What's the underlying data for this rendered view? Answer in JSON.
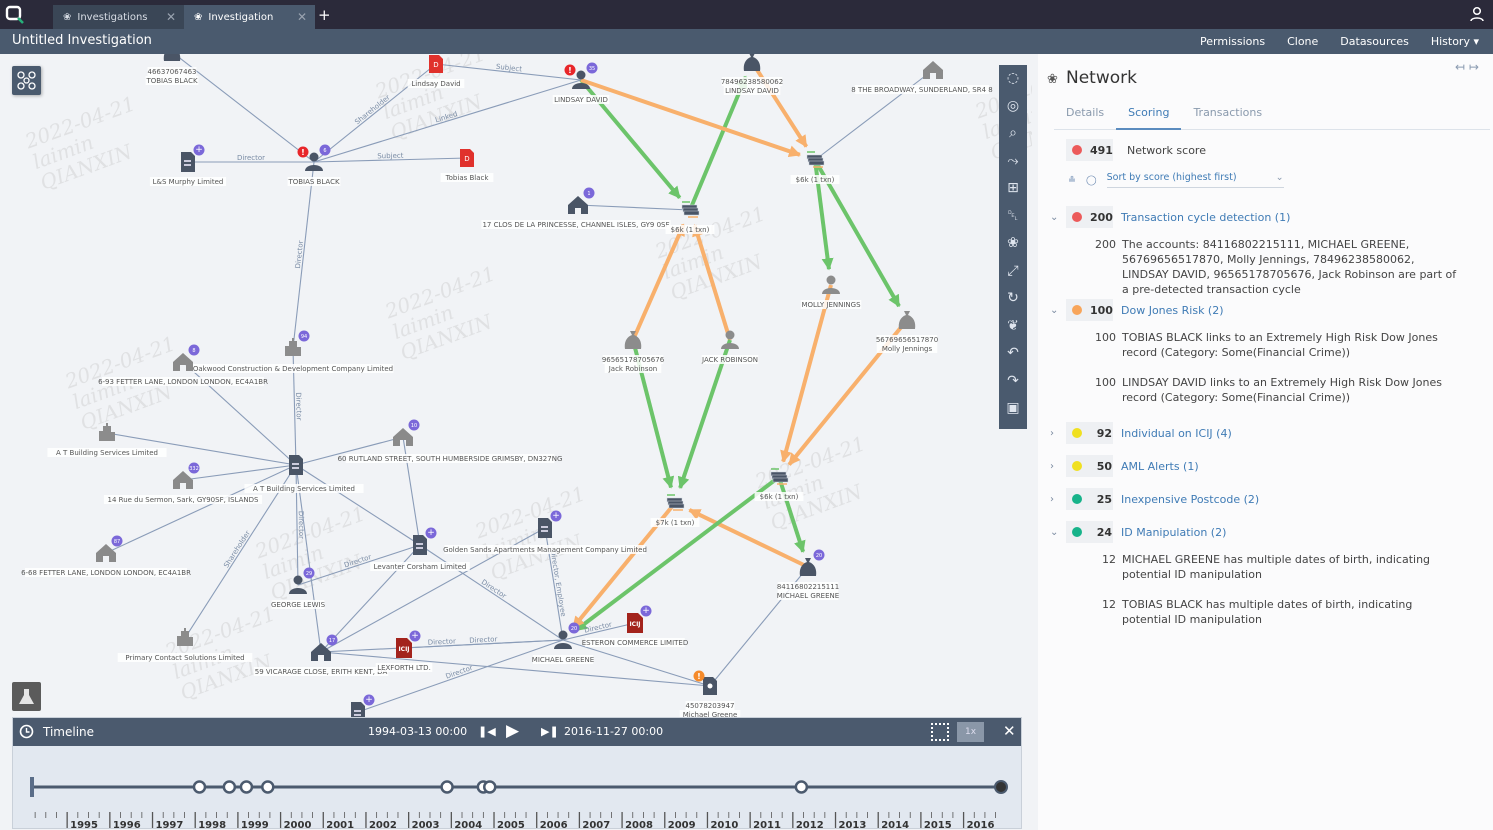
{
  "app": {
    "tabs": [
      {
        "label": "Investigations",
        "icon": "network-icon",
        "active": false
      },
      {
        "label": "Investigation",
        "icon": "network-icon",
        "active": true
      }
    ],
    "title": "Untitled Investigation",
    "menu": [
      "Permissions",
      "Clone",
      "Datasources",
      "History"
    ]
  },
  "watermark": "2022-04-21\nlaimin\nQIANXIN",
  "colors": {
    "green": "#6cc46a",
    "orange": "#f8b06c",
    "link": "#8a9cb8",
    "badge": "#7b68d9",
    "alert_red": "#e8262a",
    "alert_orange": "#f58a2a",
    "icij_red": "#a3231c",
    "doc_red": "#e0312c"
  },
  "graph": {
    "nodes": [
      {
        "id": "acct_tobias",
        "type": "moneybag",
        "label": [
          "46637067463",
          "TOBIAS BLACK"
        ]
      },
      {
        "id": "doc_lindsay",
        "type": "doc-red",
        "label": [
          "Lindsay David"
        ]
      },
      {
        "id": "tobias",
        "type": "person",
        "label": [
          "TOBIAS BLACK"
        ],
        "alert": "red",
        "badge": "6"
      },
      {
        "id": "lsmurphy",
        "type": "company",
        "label": [
          "L&S Murphy Limited"
        ],
        "badge": "+"
      },
      {
        "id": "doc_tobias",
        "type": "doc-red",
        "label": [
          "Tobias Black"
        ]
      },
      {
        "id": "lindsay",
        "type": "person",
        "label": [
          "LINDSAY DAVID"
        ],
        "alert": "red",
        "badge": "35"
      },
      {
        "id": "acct_lindsay",
        "type": "moneybag",
        "label": [
          "78496238580062",
          "LINDSAY DAVID"
        ]
      },
      {
        "id": "broadway",
        "type": "house-gray",
        "label": [
          "8 THE BROADWAY, SUNDERLAND, SR4 8"
        ]
      },
      {
        "id": "clos",
        "type": "house",
        "label": [
          "17 CLOS DE LA PRINCESSE, CHANNEL ISLES, GY9 0SF"
        ],
        "badge": "1"
      },
      {
        "id": "txn1",
        "type": "txn",
        "label": [
          "$6k (1 txn)"
        ]
      },
      {
        "id": "txn2",
        "type": "txn",
        "label": [
          "$6k (1 txn)"
        ]
      },
      {
        "id": "acct_jack",
        "type": "moneybag-gray",
        "label": [
          "96565178705676",
          "Jack Robinson"
        ]
      },
      {
        "id": "jack",
        "type": "person-gray",
        "label": [
          "JACK ROBINSON"
        ]
      },
      {
        "id": "molly",
        "type": "person-gray",
        "label": [
          "MOLLY JENNINGS"
        ]
      },
      {
        "id": "acct_molly",
        "type": "moneybag-gray",
        "label": [
          "56769656517870",
          "Molly Jennings"
        ]
      },
      {
        "id": "oakwood",
        "type": "building",
        "label": [
          "Oakwood Construction & Development Company Limited"
        ],
        "badge": "94"
      },
      {
        "id": "fetter93",
        "type": "house-gray",
        "label": [
          "6-93 FETTER LANE, LONDON LONDON, EC4A1BR"
        ],
        "badge": "8"
      },
      {
        "id": "atbs_bldg",
        "type": "building",
        "label": [
          "A T Building Services Limited"
        ]
      },
      {
        "id": "atbs",
        "type": "company",
        "label": [
          "A T Building Services Limited"
        ]
      },
      {
        "id": "rutland",
        "type": "none",
        "label": [
          "60 RUTLAND STREET, SOUTH HUMBERSIDE GRIMSBY, DN327NG"
        ]
      },
      {
        "id": "house10",
        "type": "house-gray",
        "label": [],
        "badge": "10"
      },
      {
        "id": "rue",
        "type": "house-gray",
        "label": [
          "14 Rue du Sermon, Sark, GY90SF, ISLANDS"
        ],
        "badge": "332"
      },
      {
        "id": "fetter68",
        "type": "house-gray",
        "label": [
          "6-68 FETTER LANE, LONDON LONDON, EC4A1BR"
        ],
        "badge": "87"
      },
      {
        "id": "george",
        "type": "person",
        "label": [
          "GEORGE LEWIS"
        ],
        "badge": "29"
      },
      {
        "id": "levanter",
        "type": "company",
        "label": [
          "Levanter Corsham Limited"
        ],
        "badge": "+"
      },
      {
        "id": "golden",
        "type": "company",
        "label": [
          "Golden Sands Apartments Management Company Limited"
        ],
        "badge": "+"
      },
      {
        "id": "txn3",
        "type": "txn",
        "label": [
          "$7k (1 txn)"
        ]
      },
      {
        "id": "txn4",
        "type": "txn",
        "label": [
          "$6k (1 txn)"
        ]
      },
      {
        "id": "acct_michael",
        "type": "moneybag",
        "label": [
          "84116802215111",
          "MICHAEL GREENE"
        ],
        "badge": "20"
      },
      {
        "id": "primary",
        "type": "building",
        "label": [
          "Primary Contact Solutions Limited"
        ]
      },
      {
        "id": "vicarage",
        "type": "house",
        "label": [
          "59 VICARAGE CLOSE, ERITH KENT, DA"
        ],
        "badge": "17"
      },
      {
        "id": "lexforth",
        "type": "icij",
        "label": [
          "LEXFORTH LTD."
        ],
        "badge": "+"
      },
      {
        "id": "michael",
        "type": "person",
        "label": [
          "MICHAEL GREENE"
        ],
        "badge": "20"
      },
      {
        "id": "esteron",
        "type": "icij",
        "label": [
          "ESTERON COMMERCE LIMITED"
        ],
        "badge": "+"
      },
      {
        "id": "id_michael",
        "type": "id-doc",
        "label": [
          "45078203947",
          "Michael Greene"
        ],
        "alert": "orange"
      },
      {
        "id": "bottom_co",
        "type": "company",
        "label": [],
        "badge": "+"
      }
    ],
    "edges": [
      {
        "from": "acct_tobias",
        "to": "tobias",
        "kind": "link",
        "label": ""
      },
      {
        "from": "tobias",
        "to": "doc_lindsay",
        "kind": "link",
        "label": "Shareholder"
      },
      {
        "from": "tobias",
        "to": "lindsay",
        "kind": "link",
        "label": "Linked"
      },
      {
        "from": "lsmurphy",
        "to": "tobias",
        "kind": "link",
        "label": "Director"
      },
      {
        "from": "tobias",
        "to": "doc_tobias",
        "kind": "link",
        "label": "Subject"
      },
      {
        "from": "doc_lindsay",
        "to": "lindsay",
        "kind": "link",
        "label": "Subject"
      },
      {
        "from": "tobias",
        "to": "oakwood",
        "kind": "link",
        "label": "Director"
      },
      {
        "from": "broadway",
        "to": "txn2",
        "kind": "link",
        "label": ""
      },
      {
        "from": "clos",
        "to": "txn1",
        "kind": "link",
        "label": ""
      },
      {
        "from": "lindsay",
        "to": "txn1",
        "kind": "green",
        "label": ""
      },
      {
        "from": "txn1",
        "to": "acct_lindsay",
        "kind": "green",
        "label": ""
      },
      {
        "from": "lindsay",
        "to": "txn2",
        "kind": "orange",
        "label": ""
      },
      {
        "from": "acct_lindsay",
        "to": "txn2",
        "kind": "orange",
        "label": ""
      },
      {
        "from": "acct_jack",
        "to": "txn1",
        "kind": "orange",
        "label": ""
      },
      {
        "from": "jack",
        "to": "txn1",
        "kind": "orange",
        "label": ""
      },
      {
        "from": "txn2",
        "to": "molly",
        "kind": "green",
        "label": ""
      },
      {
        "from": "txn2",
        "to": "acct_molly",
        "kind": "green",
        "label": ""
      },
      {
        "from": "acct_jack",
        "to": "txn3",
        "kind": "green",
        "label": ""
      },
      {
        "from": "jack",
        "to": "txn3",
        "kind": "green",
        "label": ""
      },
      {
        "from": "molly",
        "to": "txn4",
        "kind": "orange",
        "label": ""
      },
      {
        "from": "acct_molly",
        "to": "txn4",
        "kind": "orange",
        "label": ""
      },
      {
        "from": "acct_michael",
        "to": "txn3",
        "kind": "orange",
        "label": ""
      },
      {
        "from": "txn4",
        "to": "acct_michael",
        "kind": "green",
        "label": ""
      },
      {
        "from": "txn4",
        "to": "michael",
        "kind": "green",
        "label": ""
      },
      {
        "from": "txn3",
        "to": "michael",
        "kind": "orange",
        "label": ""
      },
      {
        "from": "oakwood",
        "to": "atbs",
        "kind": "link",
        "label": "Director"
      },
      {
        "from": "fetter93",
        "to": "atbs",
        "kind": "link",
        "label": ""
      },
      {
        "from": "atbs_bldg",
        "to": "atbs",
        "kind": "link",
        "label": ""
      },
      {
        "from": "rue",
        "to": "atbs",
        "kind": "link",
        "label": ""
      },
      {
        "from": "fetter68",
        "to": "atbs",
        "kind": "link",
        "label": ""
      },
      {
        "from": "house10",
        "to": "atbs",
        "kind": "link",
        "label": ""
      },
      {
        "from": "atbs",
        "to": "george",
        "kind": "link",
        "label": "Director"
      },
      {
        "from": "atbs",
        "to": "vicarage",
        "kind": "link",
        "label": ""
      },
      {
        "from": "atbs",
        "to": "primary",
        "kind": "link",
        "label": "Shareholder"
      },
      {
        "from": "atbs",
        "to": "levanter",
        "kind": "link",
        "label": ""
      },
      {
        "from": "house10",
        "to": "levanter",
        "kind": "link",
        "label": ""
      },
      {
        "from": "george",
        "to": "levanter",
        "kind": "link",
        "label": "Director"
      },
      {
        "from": "levanter",
        "to": "michael",
        "kind": "link",
        "label": "Director"
      },
      {
        "from": "golden",
        "to": "michael",
        "kind": "link",
        "label": "Director, Employee"
      },
      {
        "from": "vicarage",
        "to": "golden",
        "kind": "link",
        "label": ""
      },
      {
        "from": "vicarage",
        "to": "levanter",
        "kind": "link",
        "label": ""
      },
      {
        "from": "vicarage",
        "to": "michael",
        "kind": "link",
        "label": "Director"
      },
      {
        "from": "lexforth",
        "to": "michael",
        "kind": "link",
        "label": "Director"
      },
      {
        "from": "esteron",
        "to": "michael",
        "kind": "link",
        "label": "Director"
      },
      {
        "from": "bottom_co",
        "to": "michael",
        "kind": "link",
        "label": "Director"
      },
      {
        "from": "michael",
        "to": "id_michael",
        "kind": "link",
        "label": ""
      },
      {
        "from": "acct_michael",
        "to": "id_michael",
        "kind": "link",
        "label": ""
      },
      {
        "from": "vicarage",
        "to": "id_michael",
        "kind": "link",
        "label": ""
      }
    ]
  },
  "toolbar": [
    "lasso-select-icon",
    "radial-select-icon",
    "search-icon",
    "route-icon",
    "add-file-icon",
    "trash-icon",
    "network-icon",
    "expand-icon",
    "refresh-icon",
    "leaf-icon",
    "undo-icon",
    "redo-icon",
    "camera-icon"
  ],
  "timeline": {
    "title": "Timeline",
    "start": "1994-03-13 00:00",
    "end": "2016-11-27 00:00",
    "speed": "1x",
    "years": [
      "1995",
      "1996",
      "1997",
      "1998",
      "1999",
      "2000",
      "2001",
      "2002",
      "2003",
      "2004",
      "2005",
      "2006",
      "2007",
      "2008",
      "2009",
      "2010",
      "2011",
      "2012",
      "2013",
      "2014",
      "2015",
      "2016"
    ],
    "event_years": [
      1998.1,
      1998.8,
      1999.2,
      1999.7,
      2003.9,
      2004.75,
      2004.9,
      2012.2
    ],
    "range": [
      1994.2,
      2016.9
    ]
  },
  "panel": {
    "title": "Network",
    "tabs": [
      "Details",
      "Scoring",
      "Transactions"
    ],
    "active_tab": "Scoring",
    "network_score": {
      "score": "491",
      "label": "Network score",
      "color": "#ec5a5a"
    },
    "sort_label": "Sort by score (highest first)",
    "categories": [
      {
        "score": "200",
        "label": "Transaction cycle detection (1)",
        "color": "#ec5a5a",
        "expanded": true,
        "details": [
          {
            "score": "200",
            "text": "The accounts: 84116802215111, MICHAEL GREENE, 56769656517870, Molly Jennings, 78496238580062, LINDSAY DAVID, 96565178705676, Jack Robinson are part of a pre-detected transaction cycle"
          }
        ]
      },
      {
        "score": "100",
        "label": "Dow Jones Risk (2)",
        "color": "#f8a55a",
        "expanded": true,
        "details": [
          {
            "score": "100",
            "text": "TOBIAS BLACK links to an Extremely High Risk Dow Jones record (Category: Some(Financial Crime))"
          },
          {
            "score": "100",
            "text": "LINDSAY DAVID links to an Extremely High Risk Dow Jones record (Category: Some(Financial Crime))"
          }
        ]
      },
      {
        "score": "92",
        "label": "Individual on ICIJ (4)",
        "color": "#f0e020",
        "expanded": false,
        "details": []
      },
      {
        "score": "50",
        "label": "AML Alerts (1)",
        "color": "#f0e020",
        "expanded": false,
        "details": []
      },
      {
        "score": "25",
        "label": "Inexpensive Postcode (2)",
        "color": "#17b38a",
        "expanded": false,
        "details": []
      },
      {
        "score": "24",
        "label": "ID Manipulation (2)",
        "color": "#17b38a",
        "expanded": true,
        "details": [
          {
            "score": "12",
            "text": "MICHAEL GREENE has multiple dates of birth, indicating potential ID manipulation"
          },
          {
            "score": "12",
            "text": "TOBIAS BLACK has multiple dates of birth, indicating potential ID manipulation"
          }
        ]
      }
    ]
  }
}
